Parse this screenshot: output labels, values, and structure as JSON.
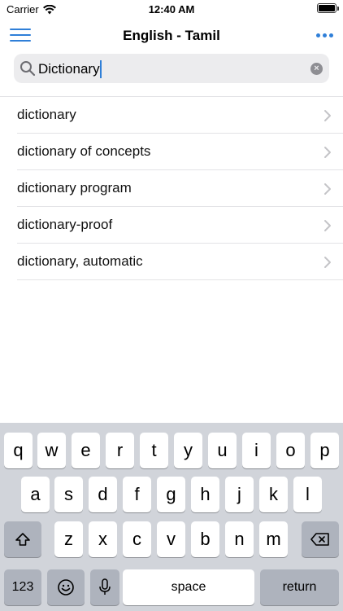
{
  "status_bar": {
    "carrier": "Carrier",
    "time": "12:40 AM"
  },
  "nav": {
    "title": "English - Tamil"
  },
  "search": {
    "value": "Dictionary",
    "clear_label": "×"
  },
  "results": [
    {
      "label": "dictionary"
    },
    {
      "label": "dictionary of concepts"
    },
    {
      "label": "dictionary program"
    },
    {
      "label": "dictionary-proof"
    },
    {
      "label": "dictionary, automatic"
    }
  ],
  "keyboard": {
    "row1": [
      "q",
      "w",
      "e",
      "r",
      "t",
      "y",
      "u",
      "i",
      "o",
      "p"
    ],
    "row2": [
      "a",
      "s",
      "d",
      "f",
      "g",
      "h",
      "j",
      "k",
      "l"
    ],
    "row3": [
      "z",
      "x",
      "c",
      "v",
      "b",
      "n",
      "m"
    ],
    "numbers_label": "123",
    "space_label": "space",
    "return_label": "return"
  },
  "colors": {
    "accent": "#2f7fd8",
    "keyboard_bg": "#d1d4da",
    "search_bg": "#ececee"
  }
}
